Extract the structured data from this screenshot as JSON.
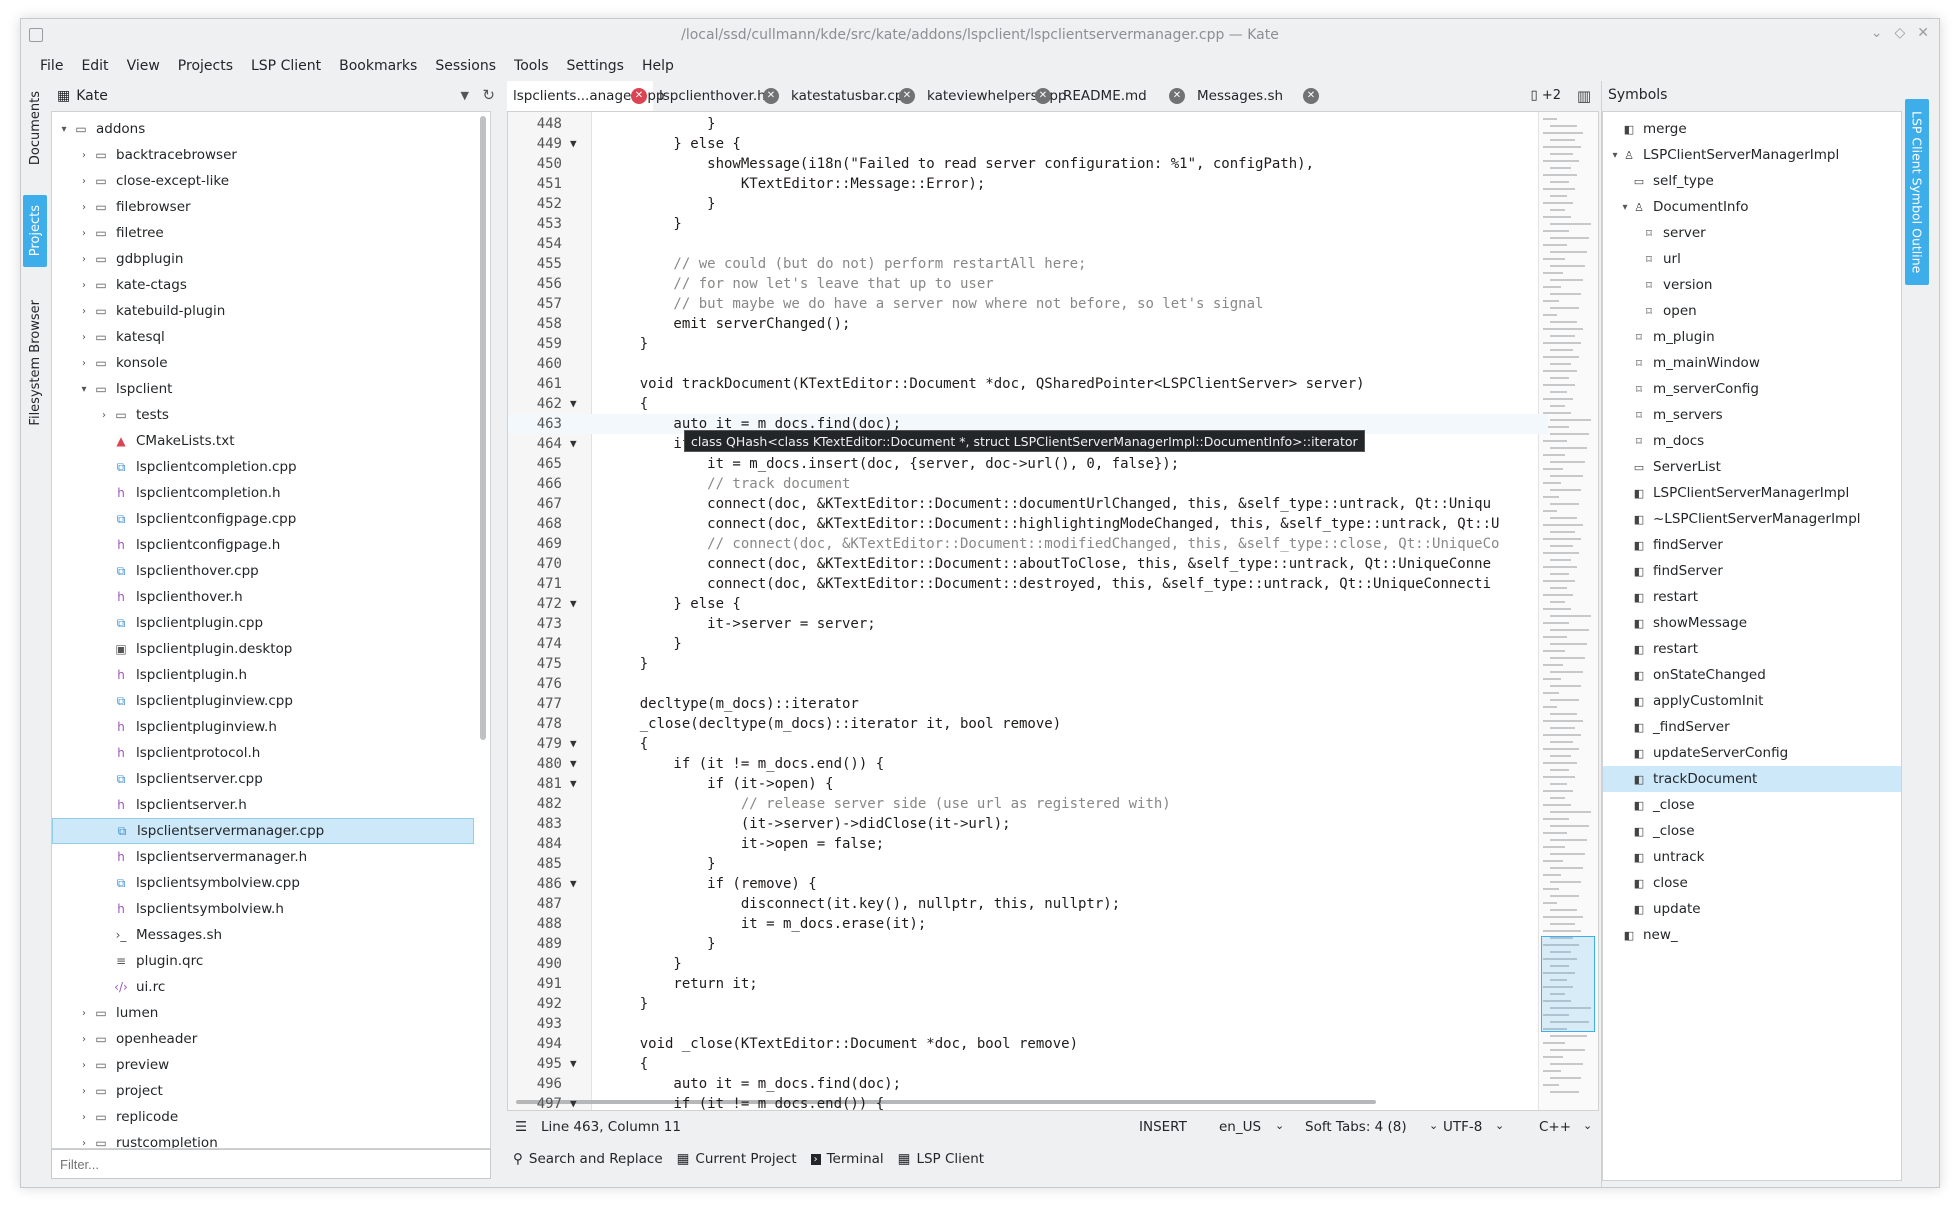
{
  "window": {
    "title": "/local/ssd/cullmann/kde/src/kate/addons/lspclient/lspclientservermanager.cpp — Kate",
    "controls": [
      "⌄",
      "◇",
      "✕"
    ]
  },
  "menu": [
    "File",
    "Edit",
    "View",
    "Projects",
    "LSP Client",
    "Bookmarks",
    "Sessions",
    "Tools",
    "Settings",
    "Help"
  ],
  "left_strip": {
    "documents": "Documents",
    "projects": "Projects",
    "filesystem": "Filesystem Browser"
  },
  "projects_panel": {
    "project_name": "Kate",
    "filter_placeholder": "Filter...",
    "tree": [
      {
        "label": "addons",
        "type": "folder",
        "arrow": "▾",
        "depth": 0
      },
      {
        "label": "backtracebrowser",
        "type": "folder",
        "arrow": "›",
        "depth": 1
      },
      {
        "label": "close-except-like",
        "type": "folder",
        "arrow": "›",
        "depth": 1
      },
      {
        "label": "filebrowser",
        "type": "folder",
        "arrow": "›",
        "depth": 1
      },
      {
        "label": "filetree",
        "type": "folder",
        "arrow": "›",
        "depth": 1
      },
      {
        "label": "gdbplugin",
        "type": "folder",
        "arrow": "›",
        "depth": 1
      },
      {
        "label": "kate-ctags",
        "type": "folder",
        "arrow": "›",
        "depth": 1
      },
      {
        "label": "katebuild-plugin",
        "type": "folder",
        "arrow": "›",
        "depth": 1
      },
      {
        "label": "katesql",
        "type": "folder",
        "arrow": "›",
        "depth": 1
      },
      {
        "label": "konsole",
        "type": "folder",
        "arrow": "›",
        "depth": 1
      },
      {
        "label": "lspclient",
        "type": "folder",
        "arrow": "▾",
        "depth": 1
      },
      {
        "label": "tests",
        "type": "folder",
        "arrow": "›",
        "depth": 2
      },
      {
        "label": "CMakeLists.txt",
        "type": "cmake",
        "arrow": "",
        "depth": 2
      },
      {
        "label": "lspclientcompletion.cpp",
        "type": "cpp",
        "arrow": "",
        "depth": 2
      },
      {
        "label": "lspclientcompletion.h",
        "type": "h",
        "arrow": "",
        "depth": 2
      },
      {
        "label": "lspclientconfigpage.cpp",
        "type": "cpp",
        "arrow": "",
        "depth": 2
      },
      {
        "label": "lspclientconfigpage.h",
        "type": "h",
        "arrow": "",
        "depth": 2
      },
      {
        "label": "lspclienthover.cpp",
        "type": "cpp",
        "arrow": "",
        "depth": 2
      },
      {
        "label": "lspclienthover.h",
        "type": "h",
        "arrow": "",
        "depth": 2
      },
      {
        "label": "lspclientplugin.cpp",
        "type": "cpp",
        "arrow": "",
        "depth": 2
      },
      {
        "label": "lspclientplugin.desktop",
        "type": "desktop",
        "arrow": "",
        "depth": 2
      },
      {
        "label": "lspclientplugin.h",
        "type": "h",
        "arrow": "",
        "depth": 2
      },
      {
        "label": "lspclientpluginview.cpp",
        "type": "cpp",
        "arrow": "",
        "depth": 2
      },
      {
        "label": "lspclientpluginview.h",
        "type": "h",
        "arrow": "",
        "depth": 2
      },
      {
        "label": "lspclientprotocol.h",
        "type": "h",
        "arrow": "",
        "depth": 2
      },
      {
        "label": "lspclientserver.cpp",
        "type": "cpp",
        "arrow": "",
        "depth": 2
      },
      {
        "label": "lspclientserver.h",
        "type": "h",
        "arrow": "",
        "depth": 2
      },
      {
        "label": "lspclientservermanager.cpp",
        "type": "cpp",
        "arrow": "",
        "depth": 2,
        "selected": true
      },
      {
        "label": "lspclientservermanager.h",
        "type": "h",
        "arrow": "",
        "depth": 2
      },
      {
        "label": "lspclientsymbolview.cpp",
        "type": "cpp",
        "arrow": "",
        "depth": 2
      },
      {
        "label": "lspclientsymbolview.h",
        "type": "h",
        "arrow": "",
        "depth": 2
      },
      {
        "label": "Messages.sh",
        "type": "sh",
        "arrow": "",
        "depth": 2
      },
      {
        "label": "plugin.qrc",
        "type": "qrc",
        "arrow": "",
        "depth": 2
      },
      {
        "label": "ui.rc",
        "type": "rc",
        "arrow": "",
        "depth": 2
      },
      {
        "label": "lumen",
        "type": "folder",
        "arrow": "›",
        "depth": 1
      },
      {
        "label": "openheader",
        "type": "folder",
        "arrow": "›",
        "depth": 1
      },
      {
        "label": "preview",
        "type": "folder",
        "arrow": "›",
        "depth": 1
      },
      {
        "label": "project",
        "type": "folder",
        "arrow": "›",
        "depth": 1
      },
      {
        "label": "replicode",
        "type": "folder",
        "arrow": "›",
        "depth": 1
      },
      {
        "label": "rustcompletion",
        "type": "folder",
        "arrow": "›",
        "depth": 1
      }
    ]
  },
  "tabs": [
    {
      "label": "lspclients...anager.cpp",
      "active": true
    },
    {
      "label": "lspclienthover.h",
      "active": false
    },
    {
      "label": "katestatusbar.cpp",
      "active": false
    },
    {
      "label": "kateviewhelpers.cpp",
      "active": false
    },
    {
      "label": "README.md",
      "active": false
    },
    {
      "label": "Messages.sh",
      "active": false
    }
  ],
  "tab_more": "+2",
  "code": [
    {
      "n": "448",
      "fold": "",
      "text": "            }"
    },
    {
      "n": "449",
      "fold": "▼",
      "text": "        } else {"
    },
    {
      "n": "450",
      "fold": "",
      "text": "            showMessage(i18n(\"Failed to read server configuration: %1\", configPath),"
    },
    {
      "n": "451",
      "fold": "",
      "text": "                KTextEditor::Message::Error);"
    },
    {
      "n": "452",
      "fold": "",
      "text": "            }"
    },
    {
      "n": "453",
      "fold": "",
      "text": "        }"
    },
    {
      "n": "454",
      "fold": "",
      "text": ""
    },
    {
      "n": "455",
      "fold": "",
      "text": "        // we could (but do not) perform restartAll here;"
    },
    {
      "n": "456",
      "fold": "",
      "text": "        // for now let's leave that up to user"
    },
    {
      "n": "457",
      "fold": "",
      "text": "        // but maybe we do have a server now where not before, so let's signal"
    },
    {
      "n": "458",
      "fold": "",
      "text": "        emit serverChanged();"
    },
    {
      "n": "459",
      "fold": "",
      "text": "    }"
    },
    {
      "n": "460",
      "fold": "",
      "text": ""
    },
    {
      "n": "461",
      "fold": "",
      "text": "    void trackDocument(KTextEditor::Document *doc, QSharedPointer<LSPClientServer> server)"
    },
    {
      "n": "462",
      "fold": "▼",
      "text": "    {"
    },
    {
      "n": "463",
      "fold": "",
      "text": "        auto it = m_docs.find(doc);"
    },
    {
      "n": "464",
      "fold": "▼",
      "text": "        if"
    },
    {
      "n": "465",
      "fold": "",
      "text": "            it = m_docs.insert(doc, {server, doc->url(), 0, false});"
    },
    {
      "n": "466",
      "fold": "",
      "text": "            // track document"
    },
    {
      "n": "467",
      "fold": "",
      "text": "            connect(doc, &KTextEditor::Document::documentUrlChanged, this, &self_type::untrack, Qt::Uniqu"
    },
    {
      "n": "468",
      "fold": "",
      "text": "            connect(doc, &KTextEditor::Document::highlightingModeChanged, this, &self_type::untrack, Qt::U"
    },
    {
      "n": "469",
      "fold": "",
      "text": "            // connect(doc, &KTextEditor::Document::modifiedChanged, this, &self_type::close, Qt::UniqueCo"
    },
    {
      "n": "470",
      "fold": "",
      "text": "            connect(doc, &KTextEditor::Document::aboutToClose, this, &self_type::untrack, Qt::UniqueConne"
    },
    {
      "n": "471",
      "fold": "",
      "text": "            connect(doc, &KTextEditor::Document::destroyed, this, &self_type::untrack, Qt::UniqueConnecti"
    },
    {
      "n": "472",
      "fold": "▼",
      "text": "        } else {"
    },
    {
      "n": "473",
      "fold": "",
      "text": "            it->server = server;"
    },
    {
      "n": "474",
      "fold": "",
      "text": "        }"
    },
    {
      "n": "475",
      "fold": "",
      "text": "    }"
    },
    {
      "n": "476",
      "fold": "",
      "text": ""
    },
    {
      "n": "477",
      "fold": "",
      "text": "    decltype(m_docs)::iterator"
    },
    {
      "n": "478",
      "fold": "",
      "text": "    _close(decltype(m_docs)::iterator it, bool remove)"
    },
    {
      "n": "479",
      "fold": "▼",
      "text": "    {"
    },
    {
      "n": "480",
      "fold": "▼",
      "text": "        if (it != m_docs.end()) {"
    },
    {
      "n": "481",
      "fold": "▼",
      "text": "            if (it->open) {"
    },
    {
      "n": "482",
      "fold": "",
      "text": "                // release server side (use url as registered with)"
    },
    {
      "n": "483",
      "fold": "",
      "text": "                (it->server)->didClose(it->url);"
    },
    {
      "n": "484",
      "fold": "",
      "text": "                it->open = false;"
    },
    {
      "n": "485",
      "fold": "",
      "text": "            }"
    },
    {
      "n": "486",
      "fold": "▼",
      "text": "            if (remove) {"
    },
    {
      "n": "487",
      "fold": "",
      "text": "                disconnect(it.key(), nullptr, this, nullptr);"
    },
    {
      "n": "488",
      "fold": "",
      "text": "                it = m_docs.erase(it);"
    },
    {
      "n": "489",
      "fold": "",
      "text": "            }"
    },
    {
      "n": "490",
      "fold": "",
      "text": "        }"
    },
    {
      "n": "491",
      "fold": "",
      "text": "        return it;"
    },
    {
      "n": "492",
      "fold": "",
      "text": "    }"
    },
    {
      "n": "493",
      "fold": "",
      "text": ""
    },
    {
      "n": "494",
      "fold": "",
      "text": "    void _close(KTextEditor::Document *doc, bool remove)"
    },
    {
      "n": "495",
      "fold": "▼",
      "text": "    {"
    },
    {
      "n": "496",
      "fold": "",
      "text": "        auto it = m_docs.find(doc);"
    },
    {
      "n": "497",
      "fold": "▼",
      "text": "        if (it != m_docs.end()) {"
    }
  ],
  "current_line": "463",
  "tooltip": "class QHash<class KTextEditor::Document *, struct LSPClientServerManagerImpl::DocumentInfo>::iterator",
  "status": {
    "position": "Line 463, Column 11",
    "mode": "INSERT",
    "language": "en_US",
    "indent": "Soft Tabs: 4 (8)",
    "encoding": "UTF-8",
    "syntax": "C++"
  },
  "bottom_tools": [
    "Search and Replace",
    "Current Project",
    "Terminal",
    "LSP Client"
  ],
  "symbols_panel": {
    "title": "Symbols",
    "side_tab": "LSP Client Symbol Outline",
    "items": [
      {
        "label": "merge",
        "depth": 0,
        "icon": "fn",
        "arrow": ""
      },
      {
        "label": "LSPClientServerManagerImpl",
        "depth": 0,
        "icon": "class",
        "arrow": "▾"
      },
      {
        "label": "self_type",
        "depth": 1,
        "icon": "type",
        "arrow": ""
      },
      {
        "label": "DocumentInfo",
        "depth": 1,
        "icon": "class",
        "arrow": "▾"
      },
      {
        "label": "server",
        "depth": 2,
        "icon": "var",
        "arrow": ""
      },
      {
        "label": "url",
        "depth": 2,
        "icon": "var",
        "arrow": ""
      },
      {
        "label": "version",
        "depth": 2,
        "icon": "var",
        "arrow": ""
      },
      {
        "label": "open",
        "depth": 2,
        "icon": "var",
        "arrow": ""
      },
      {
        "label": "m_plugin",
        "depth": 1,
        "icon": "var",
        "arrow": ""
      },
      {
        "label": "m_mainWindow",
        "depth": 1,
        "icon": "var",
        "arrow": ""
      },
      {
        "label": "m_serverConfig",
        "depth": 1,
        "icon": "var",
        "arrow": ""
      },
      {
        "label": "m_servers",
        "depth": 1,
        "icon": "var",
        "arrow": ""
      },
      {
        "label": "m_docs",
        "depth": 1,
        "icon": "var",
        "arrow": ""
      },
      {
        "label": "ServerList",
        "depth": 1,
        "icon": "type",
        "arrow": ""
      },
      {
        "label": "LSPClientServerManagerImpl",
        "depth": 1,
        "icon": "fn",
        "arrow": ""
      },
      {
        "label": "~LSPClientServerManagerImpl",
        "depth": 1,
        "icon": "fn",
        "arrow": ""
      },
      {
        "label": "findServer",
        "depth": 1,
        "icon": "fn",
        "arrow": ""
      },
      {
        "label": "findServer",
        "depth": 1,
        "icon": "fn",
        "arrow": ""
      },
      {
        "label": "restart",
        "depth": 1,
        "icon": "fn",
        "arrow": ""
      },
      {
        "label": "showMessage",
        "depth": 1,
        "icon": "fn",
        "arrow": ""
      },
      {
        "label": "restart",
        "depth": 1,
        "icon": "fn",
        "arrow": ""
      },
      {
        "label": "onStateChanged",
        "depth": 1,
        "icon": "fn",
        "arrow": ""
      },
      {
        "label": "applyCustomInit",
        "depth": 1,
        "icon": "fn",
        "arrow": ""
      },
      {
        "label": "_findServer",
        "depth": 1,
        "icon": "fn",
        "arrow": ""
      },
      {
        "label": "updateServerConfig",
        "depth": 1,
        "icon": "fn",
        "arrow": ""
      },
      {
        "label": "trackDocument",
        "depth": 1,
        "icon": "fn",
        "arrow": "",
        "selected": true
      },
      {
        "label": "_close",
        "depth": 1,
        "icon": "fn",
        "arrow": ""
      },
      {
        "label": "_close",
        "depth": 1,
        "icon": "fn",
        "arrow": ""
      },
      {
        "label": "untrack",
        "depth": 1,
        "icon": "fn",
        "arrow": ""
      },
      {
        "label": "close",
        "depth": 1,
        "icon": "fn",
        "arrow": ""
      },
      {
        "label": "update",
        "depth": 1,
        "icon": "fn",
        "arrow": ""
      },
      {
        "label": "new_",
        "depth": 0,
        "icon": "fn",
        "arrow": ""
      }
    ]
  },
  "colors": {
    "accent": "#3daee9",
    "selection": "#cde8f8",
    "tab_close_active": "#da4453"
  }
}
